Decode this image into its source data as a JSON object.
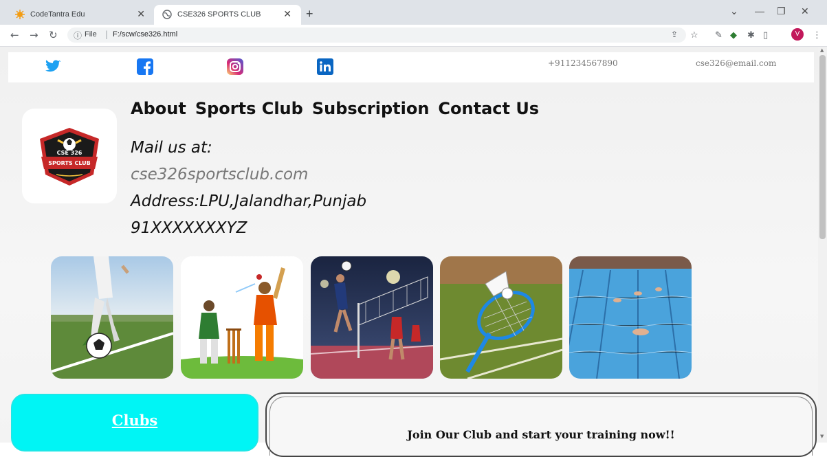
{
  "browser": {
    "tabs": [
      {
        "title": "CodeTantra Edu",
        "active": false
      },
      {
        "title": "CSE326 SPORTS CLUB",
        "active": true
      }
    ],
    "address": {
      "scheme_label": "File",
      "url": "F:/scw/cse326.html"
    },
    "profile_initial": "V"
  },
  "topbar": {
    "social": [
      "twitter-icon",
      "facebook-icon",
      "instagram-icon",
      "linkedin-icon"
    ],
    "phone": "+911234567890",
    "email": "cse326@email.com"
  },
  "logo": {
    "line1": "CSE 326",
    "line2": "SPORTS CLUB"
  },
  "nav": {
    "about": "About",
    "sports_club": "Sports Club",
    "subscription": "Subscription",
    "contact": "Contact Us"
  },
  "contact_block": {
    "mail_label": "Mail us at:",
    "mail_value": "cse326sportsclub.com",
    "address": "Address:LPU,Jalandhar,Punjab",
    "phone": "91XXXXXXXYZ"
  },
  "gallery": [
    "football",
    "cricket",
    "volleyball",
    "badminton",
    "swimming"
  ],
  "clubs_card": {
    "title": "Clubs"
  },
  "join_card": {
    "text": "Join Our Club and start your training now!!"
  },
  "colors": {
    "clubs_bg": "#00f5f5",
    "mail_value": "#777777",
    "tab_bar": "#dfe3e8"
  }
}
